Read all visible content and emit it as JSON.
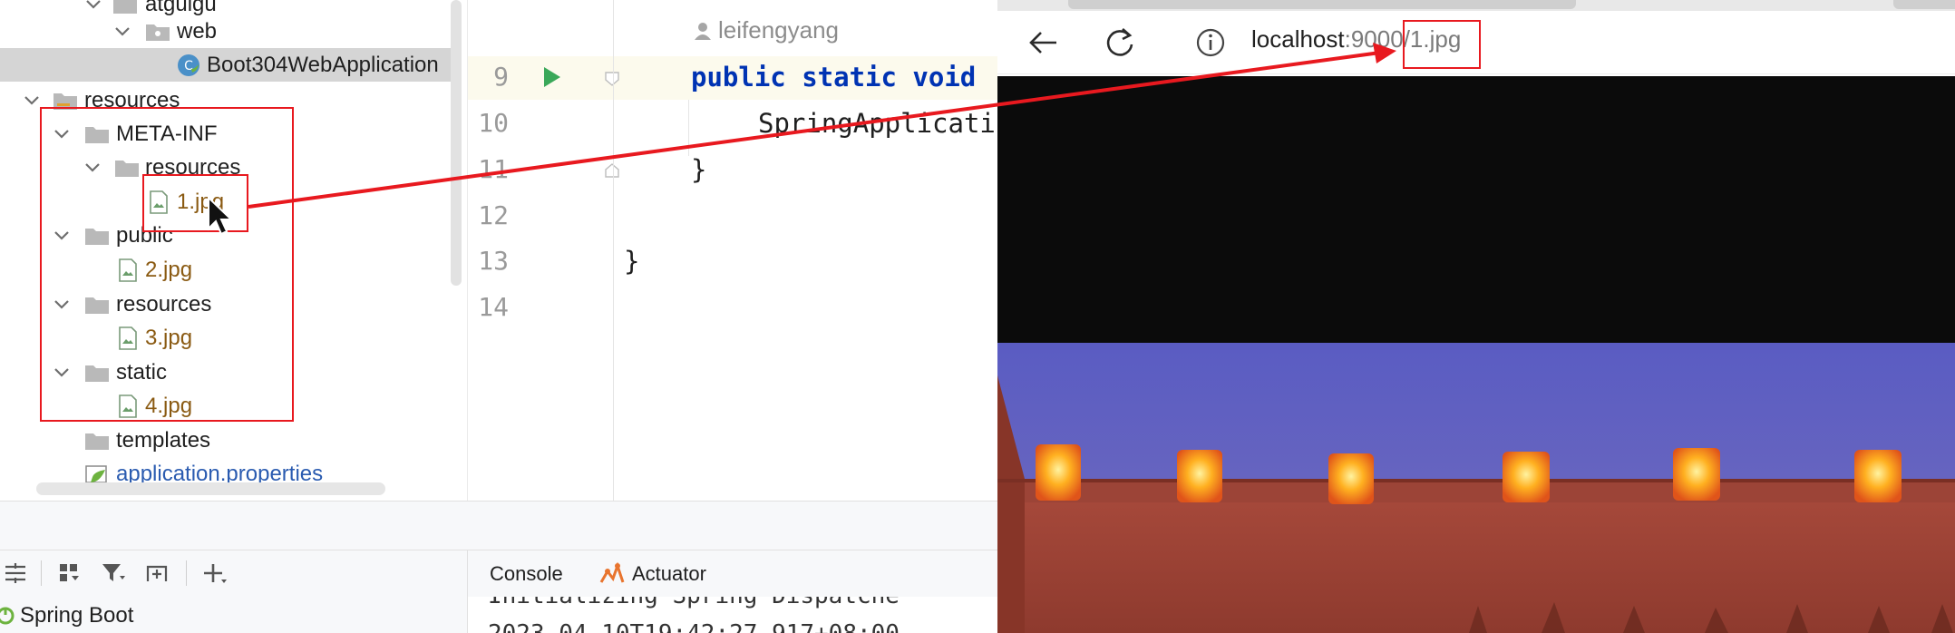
{
  "tree": {
    "items": [
      {
        "label": "atguigu"
      },
      {
        "label": "web"
      },
      {
        "label": "Boot304WebApplication"
      },
      {
        "label": "resources"
      },
      {
        "label": "META-INF"
      },
      {
        "label": "resources"
      },
      {
        "label": "1.jpg"
      },
      {
        "label": "public"
      },
      {
        "label": "2.jpg"
      },
      {
        "label": "resources"
      },
      {
        "label": "3.jpg"
      },
      {
        "label": "static"
      },
      {
        "label": "4.jpg"
      },
      {
        "label": "templates"
      },
      {
        "label": "application.properties"
      }
    ]
  },
  "editor": {
    "author": "leifengyang",
    "line_numbers": [
      "9",
      "10",
      "11",
      "12",
      "13",
      "14"
    ],
    "lines": {
      "l9_kw": "public static void",
      "l10": "SpringApplicati",
      "l11": "}",
      "l13": "}"
    }
  },
  "bottom": {
    "services_item": "Spring Boot",
    "console_tab": "Console",
    "actuator_tab": "Actuator",
    "log_line_1": "Initializing Spring Dispatche",
    "log_line_2": "2023-04-10T19:42:27.917+08:00"
  },
  "browser": {
    "url_host": "localhost",
    "url_rest": ":9000/1.jpg"
  },
  "colors": {
    "annotation_red": "#e8191f",
    "keyword": "#0033b3",
    "image_file_label": "#8a5a12",
    "properties_label": "#2a5bb0"
  }
}
